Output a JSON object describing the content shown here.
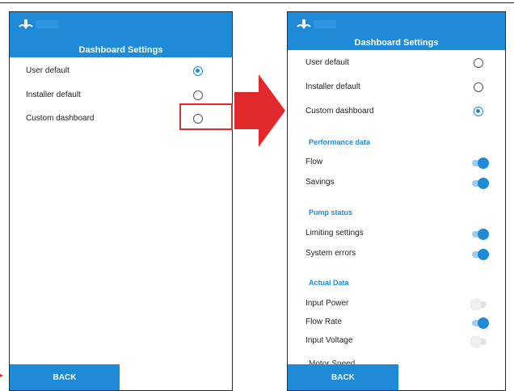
{
  "left": {
    "title": "Dashboard Settings",
    "options": [
      {
        "label": "User default",
        "selected": true
      },
      {
        "label": "Installer default",
        "selected": false
      },
      {
        "label": "Custom dashboard",
        "selected": false
      }
    ],
    "back_label": "BACK"
  },
  "right": {
    "title": "Dashboard Settings",
    "options": [
      {
        "label": "User default",
        "selected": false
      },
      {
        "label": "Installer default",
        "selected": false
      },
      {
        "label": "Custom dashboard",
        "selected": true
      }
    ],
    "sections": [
      {
        "title": "Performance data",
        "items": [
          {
            "label": "Flow",
            "on": true
          },
          {
            "label": "Savings",
            "on": true
          }
        ]
      },
      {
        "title": "Pump status",
        "items": [
          {
            "label": "Limiting settings",
            "on": true
          },
          {
            "label": "System errors",
            "on": true
          }
        ]
      },
      {
        "title": "Actual Data",
        "items": [
          {
            "label": "Input Power",
            "on": false
          },
          {
            "label": "Flow Rate",
            "on": true
          },
          {
            "label": "Input Voltage",
            "on": false
          }
        ]
      }
    ],
    "partial_item": "Motor Speed",
    "back_label": "BACK"
  },
  "colors": {
    "accent": "#1e8ad8",
    "highlight": "#e0292b"
  }
}
